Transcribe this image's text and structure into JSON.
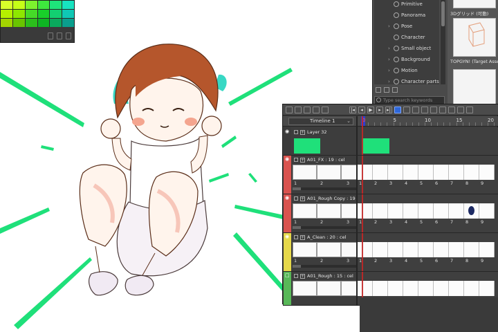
{
  "palette": {
    "swatch_colors": [
      "#d7ff2a",
      "#c6ff17",
      "#7cf32e",
      "#3ee83d",
      "#1ee57a",
      "#17e3c0",
      "#b6f000",
      "#8ee700",
      "#45db28",
      "#19cf2a",
      "#12cf71",
      "#0fc8b4",
      "#a3d400",
      "#69c400",
      "#2bbf1c",
      "#0eb523",
      "#0aa95d",
      "#0a9f8d"
    ]
  },
  "material": {
    "items": [
      {
        "label": "Primitive",
        "icon": "globe-icon",
        "has_caret": false
      },
      {
        "label": "Panorama",
        "icon": "globe-icon",
        "has_caret": false
      },
      {
        "label": "Pose",
        "icon": "figure-icon",
        "has_caret": true
      },
      {
        "label": "Character",
        "icon": "person-icon",
        "has_caret": false
      },
      {
        "label": "Small object",
        "icon": "object-icon",
        "has_caret": true
      },
      {
        "label": "Background",
        "icon": "image-icon",
        "has_caret": true
      },
      {
        "label": "Motion",
        "icon": "motion-icon",
        "has_caret": true
      },
      {
        "label": "Character parts",
        "icon": "parts-icon",
        "has_caret": true
      }
    ],
    "thumb_captions": [
      "3Dグリッド (可動)",
      "TOPGYN! (Target Asset) The Orig..."
    ],
    "search_placeholder": "Type search keywords"
  },
  "timeline": {
    "name": "Timeline 1",
    "ruler_labels": [
      "0",
      "5",
      "10",
      "15",
      "20"
    ],
    "current_frame": "0",
    "layers": [
      {
        "name": "Layer 32",
        "color": "#3b3b3b",
        "eye": true,
        "cel_numbers": []
      },
      {
        "name": "A01_FX : 19 : cel",
        "color": "#d9534f",
        "eye": true,
        "cel_numbers": [
          "1",
          "2",
          "3"
        ],
        "frame_numbers": [
          "1",
          "2",
          "3",
          "4",
          "5",
          "6",
          "7",
          "8",
          "9"
        ]
      },
      {
        "name": "A01_Rough Copy : 19 : cel",
        "color": "#d9534f",
        "eye": true,
        "cel_numbers": [
          "1",
          "2",
          "3"
        ],
        "frame_numbers": [
          "1",
          "2",
          "3",
          "4",
          "5",
          "6",
          "7",
          "8",
          "9"
        ]
      },
      {
        "name": "A_Clean : 20 : cel",
        "color": "#e6d84a",
        "eye": true,
        "cel_numbers": [
          "1",
          "2",
          "3"
        ],
        "frame_numbers": [
          "1",
          "2",
          "3",
          "4",
          "5",
          "6",
          "7",
          "8",
          "9"
        ]
      },
      {
        "name": "A01_Rough : 15 : cel",
        "color": "#58b858",
        "eye": false,
        "cel_numbers": [],
        "frame_numbers": []
      }
    ]
  },
  "colors": {
    "accent_green": "#1fe07a",
    "panel_bg": "#3c3c3c",
    "playhead": "#c22626",
    "highlight_blue": "#2e67d9"
  }
}
